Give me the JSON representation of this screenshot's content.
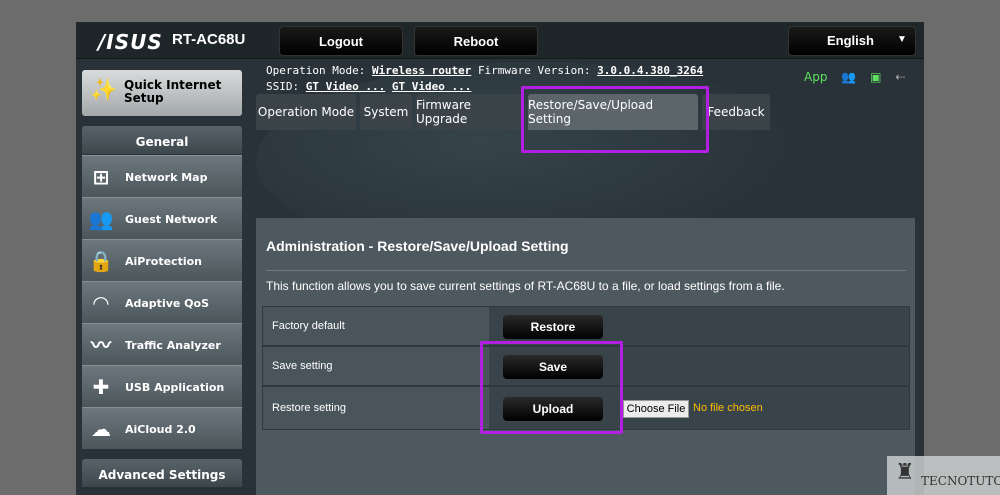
{
  "header": {
    "brand": "/ISUS",
    "model": "RT-AC68U",
    "logout_label": "Logout",
    "reboot_label": "Reboot",
    "language": "English"
  },
  "status": {
    "operation_mode_label": "Operation Mode:",
    "operation_mode_value": "Wireless router",
    "firmware_label": "Firmware Version:",
    "firmware_value": "3.0.0.4.380_3264",
    "ssid_label": "SSID:",
    "ssid_1": "GT Video ...",
    "ssid_2": "GT Video ...",
    "app_label": "App"
  },
  "sidebar": {
    "quick_setup_label": "Quick Internet Setup",
    "general_header": "General",
    "items": [
      {
        "label": "Network Map"
      },
      {
        "label": "Guest Network"
      },
      {
        "label": "AiProtection"
      },
      {
        "label": "Adaptive QoS"
      },
      {
        "label": "Traffic Analyzer"
      },
      {
        "label": "USB Application"
      },
      {
        "label": "AiCloud 2.0"
      }
    ],
    "advanced_header": "Advanced Settings"
  },
  "tabs": [
    {
      "label": "Operation Mode"
    },
    {
      "label": "System"
    },
    {
      "label": "Firmware Upgrade"
    },
    {
      "label": "Restore/Save/Upload Setting"
    },
    {
      "label": "Feedback"
    }
  ],
  "panel": {
    "title": "Administration - Restore/Save/Upload Setting",
    "description": "This function allows you to save current settings of RT-AC68U to a file, or load settings from a file.",
    "rows": [
      {
        "label": "Factory default",
        "button": "Restore"
      },
      {
        "label": "Save setting",
        "button": "Save"
      },
      {
        "label": "Restore setting",
        "button": "Upload",
        "file_button": "Choose File",
        "file_status": "No file chosen"
      }
    ]
  },
  "watermark": "TECNOTUTO",
  "colors": {
    "highlight": "#b21fe3",
    "app_green": "#5fe05f",
    "no_file": "#ffbf00"
  }
}
